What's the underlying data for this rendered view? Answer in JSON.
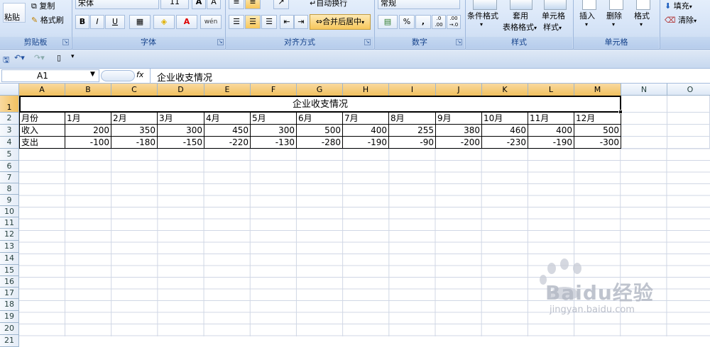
{
  "ribbon": {
    "clipboard": {
      "paste": "粘贴",
      "copy": "复制",
      "format_painter": "格式刷",
      "group": "剪贴板"
    },
    "font": {
      "name": "宋体",
      "size": "11",
      "bold": "B",
      "italic": "I",
      "underline": "U",
      "font_color_glyph": "A",
      "phonetic": "wén",
      "group": "字体"
    },
    "alignment": {
      "wrap": "自动换行",
      "merge_center": "合并后居中",
      "group": "对齐方式"
    },
    "number": {
      "format": "常规",
      "percent": "%",
      "comma": ",",
      "increase_decimal": ".0 .00",
      "decrease_decimal": ".00 →.0",
      "group": "数字"
    },
    "styles": {
      "conditional": "条件格式",
      "table_top": "套用",
      "table_bottom": "表格格式",
      "cell_top": "单元格",
      "cell_bottom": "样式",
      "group": "样式"
    },
    "cells": {
      "insert": "插入",
      "delete": "删除",
      "format": "格式",
      "group": "单元格"
    },
    "editing": {
      "fill": "填充",
      "clear": "清除"
    }
  },
  "formula_bar": {
    "name_box": "A1",
    "fx": "fx",
    "content": "企业收支情况"
  },
  "columns": [
    "A",
    "B",
    "C",
    "D",
    "E",
    "F",
    "G",
    "H",
    "I",
    "J",
    "K",
    "L",
    "M",
    "N",
    "O"
  ],
  "rows": [
    "1",
    "2",
    "3",
    "4",
    "5",
    "6",
    "7",
    "8",
    "9",
    "10",
    "11",
    "12",
    "13",
    "14",
    "15",
    "16",
    "17",
    "18",
    "19",
    "20",
    "21"
  ],
  "sheet": {
    "title": "企业收支情况",
    "header": [
      "月份",
      "1月",
      "2月",
      "3月",
      "4月",
      "5月",
      "6月",
      "7月",
      "8月",
      "9月",
      "10月",
      "11月",
      "12月"
    ],
    "income": [
      "收入",
      "200",
      "350",
      "300",
      "450",
      "300",
      "500",
      "400",
      "255",
      "380",
      "460",
      "400",
      "500"
    ],
    "expense": [
      "支出",
      "-100",
      "-180",
      "-150",
      "-220",
      "-130",
      "-280",
      "-190",
      "-90",
      "-200",
      "-230",
      "-190",
      "-300"
    ]
  },
  "watermark": {
    "brand": "Baidu经验",
    "url": "jingyan.baidu.com"
  }
}
